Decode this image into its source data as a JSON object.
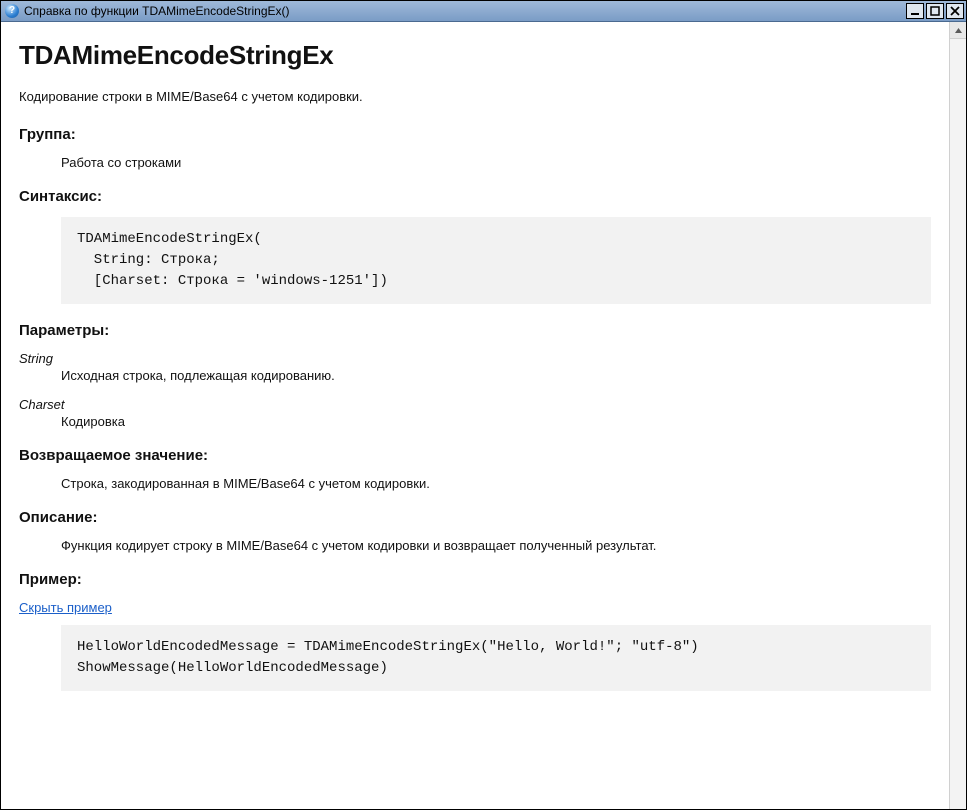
{
  "window": {
    "title": "Справка по функции TDAMimeEncodeStringEx()"
  },
  "page": {
    "heading": "TDAMimeEncodeStringEx",
    "intro": "Кодирование строки в MIME/Base64 с учетом кодировки.",
    "sections": {
      "group_label": "Группа:",
      "group_value": "Работа со строками",
      "syntax_label": "Синтаксис:",
      "syntax_code": "TDAMimeEncodeStringEx(\n  String: Строка;\n  [Charset: Строка = 'windows-1251'])",
      "params_label": "Параметры:",
      "return_label": "Возвращаемое значение:",
      "return_value": "Строка, закодированная в MIME/Base64 с учетом кодировки.",
      "desc_label": "Описание:",
      "desc_value": "Функция кодирует строку в MIME/Base64 с учетом кодировки и возвращает полученный результат.",
      "example_label": "Пример:",
      "example_toggle": "Скрыть пример",
      "example_code": "HelloWorldEncodedMessage = TDAMimeEncodeStringEx(\"Hello, World!\"; \"utf-8\")\nShowMessage(HelloWorldEncodedMessage)"
    },
    "params": [
      {
        "name": "String",
        "desc": "Исходная строка, подлежащая кодированию."
      },
      {
        "name": "Charset",
        "desc": "Кодировка"
      }
    ]
  }
}
